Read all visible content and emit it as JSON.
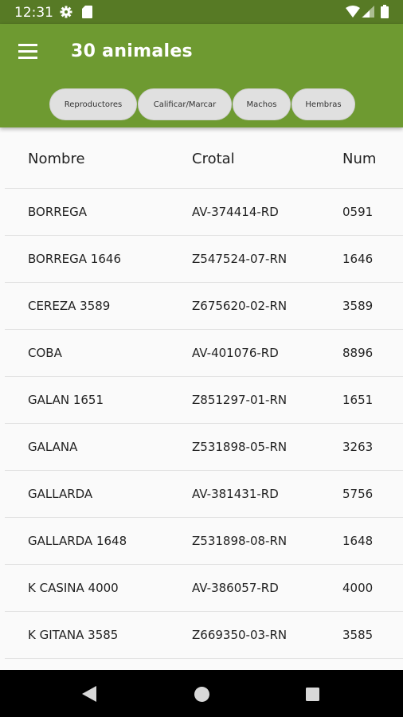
{
  "status_bar": {
    "time": "12:31",
    "icons": [
      "gear-icon",
      "sd-card-icon",
      "wifi-icon",
      "signal-icon",
      "battery-icon"
    ]
  },
  "app_bar": {
    "title": "30 animales",
    "menu_icon": "hamburger-menu-icon",
    "background_color": "#6e9a31"
  },
  "filter_chips": [
    {
      "label": "Reproductores"
    },
    {
      "label": "Calificar/Marcar"
    },
    {
      "label": "Machos"
    },
    {
      "label": "Hembras"
    }
  ],
  "table": {
    "headers": [
      "Nombre",
      "Crotal",
      "Num"
    ],
    "rows": [
      [
        "BORREGA",
        "AV-374414-RD",
        "0591"
      ],
      [
        "BORREGA 1646",
        "Z547524-07-RN",
        "1646"
      ],
      [
        "CEREZA 3589",
        "Z675620-02-RN",
        "3589"
      ],
      [
        "COBA",
        "AV-401076-RD",
        "8896"
      ],
      [
        "GALAN 1651",
        "Z851297-01-RN",
        "1651"
      ],
      [
        "GALANA",
        "Z531898-05-RN",
        "3263"
      ],
      [
        "GALLARDA",
        "AV-381431-RD",
        "5756"
      ],
      [
        "GALLARDA 1648",
        "Z531898-08-RN",
        "1648"
      ],
      [
        "K CASINA 4000",
        "AV-386057-RD",
        "4000"
      ],
      [
        "K GITANA 3585",
        "Z669350-03-RN",
        "3585"
      ]
    ]
  },
  "nav_bar": {
    "buttons": [
      "back-icon",
      "home-icon",
      "recents-icon"
    ]
  }
}
